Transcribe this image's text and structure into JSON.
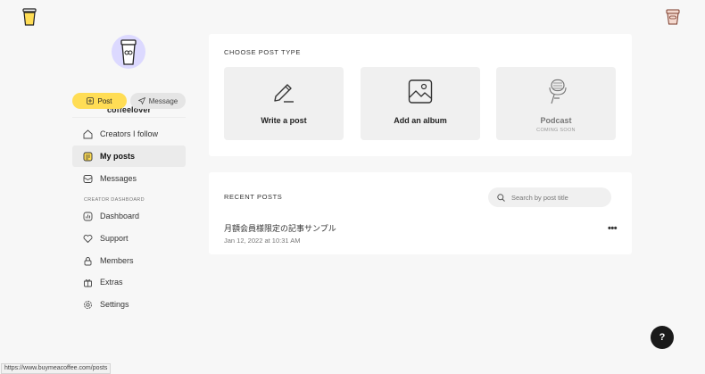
{
  "profile": {
    "username": "coffeelover"
  },
  "actions": {
    "post_label": "Post",
    "message_label": "Message"
  },
  "nav": {
    "items": [
      {
        "label": "Creators I follow",
        "icon": "home-icon"
      },
      {
        "label": "My posts",
        "icon": "posts-icon",
        "active": true
      },
      {
        "label": "Messages",
        "icon": "inbox-icon"
      }
    ],
    "section_label": "CREATOR DASHBOARD",
    "dashboard_items": [
      {
        "label": "Dashboard",
        "icon": "dashboard-icon"
      },
      {
        "label": "Support",
        "icon": "heart-icon"
      },
      {
        "label": "Members",
        "icon": "lock-icon"
      },
      {
        "label": "Extras",
        "icon": "gift-icon"
      },
      {
        "label": "Settings",
        "icon": "gear-icon"
      }
    ]
  },
  "post_type": {
    "heading": "CHOOSE POST TYPE",
    "tiles": [
      {
        "label": "Write a post",
        "icon": "pen-icon"
      },
      {
        "label": "Add an album",
        "icon": "image-icon"
      },
      {
        "label": "Podcast",
        "sub": "COMING SOON",
        "icon": "microphone-icon",
        "disabled": true
      }
    ]
  },
  "recent": {
    "heading": "RECENT POSTS",
    "search_placeholder": "Search by post title",
    "posts": [
      {
        "title": "月額会員様限定の記事サンプル",
        "date": "Jan 12, 2022 at 10:31 AM",
        "more": "•••"
      }
    ]
  },
  "help": {
    "label": "?"
  },
  "status_bar": {
    "url": "https://www.buymeacoffee.com/posts"
  },
  "colors": {
    "accent": "#ffdd55",
    "background": "#f7f7f7",
    "avatar_bg": "#dcd9ff"
  }
}
